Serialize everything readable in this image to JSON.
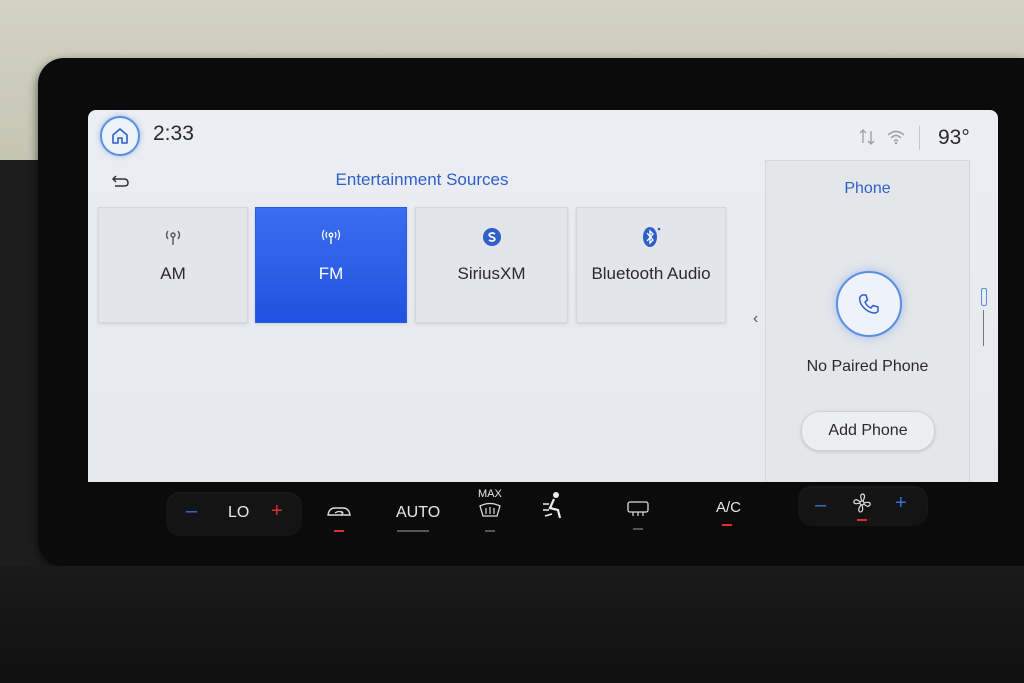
{
  "status_bar": {
    "time": "2:33",
    "temperature": "93°"
  },
  "header": {
    "title": "Entertainment Sources"
  },
  "sources": [
    {
      "label": "AM",
      "icon": "am-antenna-icon",
      "active": false
    },
    {
      "label": "FM",
      "icon": "fm-antenna-icon",
      "active": true
    },
    {
      "label": "SiriusXM",
      "icon": "siriusxm-icon",
      "active": false
    },
    {
      "label": "Bluetooth Audio",
      "icon": "bluetooth-icon",
      "active": false
    }
  ],
  "phone_panel": {
    "title": "Phone",
    "status": "No Paired Phone",
    "add_button": "Add Phone"
  },
  "climate": {
    "left_minus": "–",
    "left_temp": "LO",
    "left_plus": "+",
    "auto": "AUTO",
    "max": "MAX",
    "ac": "A/C",
    "fan_minus": "–",
    "fan_plus": "+"
  },
  "colors": {
    "accent": "#2f5fc8",
    "active_tile": "#2a5ae8",
    "indicator_on": "#e0302a"
  }
}
